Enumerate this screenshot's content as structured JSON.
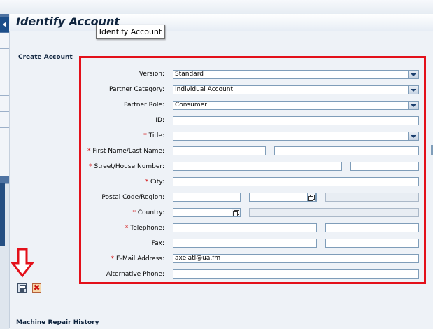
{
  "header": {
    "title": "Identify Account",
    "tooltip": "Identify Account"
  },
  "sections": {
    "create_account": "Create Account",
    "machine_repair_history": "Machine Repair History"
  },
  "form": {
    "version": {
      "label": "Version:",
      "value": "Standard"
    },
    "partner_category": {
      "label": "Partner Category:",
      "value": "Individual Account"
    },
    "partner_role": {
      "label": "Partner Role:",
      "value": "Consumer"
    },
    "id": {
      "label": "ID:",
      "value": ""
    },
    "title": {
      "label": "Title:",
      "value": ""
    },
    "name": {
      "label": "First Name/Last Name:",
      "first": "",
      "last": ""
    },
    "street": {
      "label": "Street/House Number:",
      "street": "",
      "house": ""
    },
    "city": {
      "label": "City:",
      "value": ""
    },
    "postal": {
      "label": "Postal Code/Region:",
      "code": "",
      "region": "",
      "region_desc": ""
    },
    "country": {
      "label": "Country:",
      "value": "",
      "desc": ""
    },
    "telephone": {
      "label": "Telephone:",
      "value": "",
      "ext": ""
    },
    "fax": {
      "label": "Fax:",
      "value": "",
      "ext": ""
    },
    "email": {
      "label": "E-Mail Address:",
      "value": "axelatl@ua.fm"
    },
    "alt_phone": {
      "label": "Alternative Phone:",
      "value": ""
    },
    "required_marker": "*"
  },
  "toolbar": {
    "save_icon": "save-icon",
    "cancel_icon": "cancel-icon",
    "cancel_glyph": "✖"
  },
  "colors": {
    "highlight_box": "#e3101a",
    "sidebar": "#4f74a3",
    "title": "#10253f",
    "required": "#d31414"
  }
}
